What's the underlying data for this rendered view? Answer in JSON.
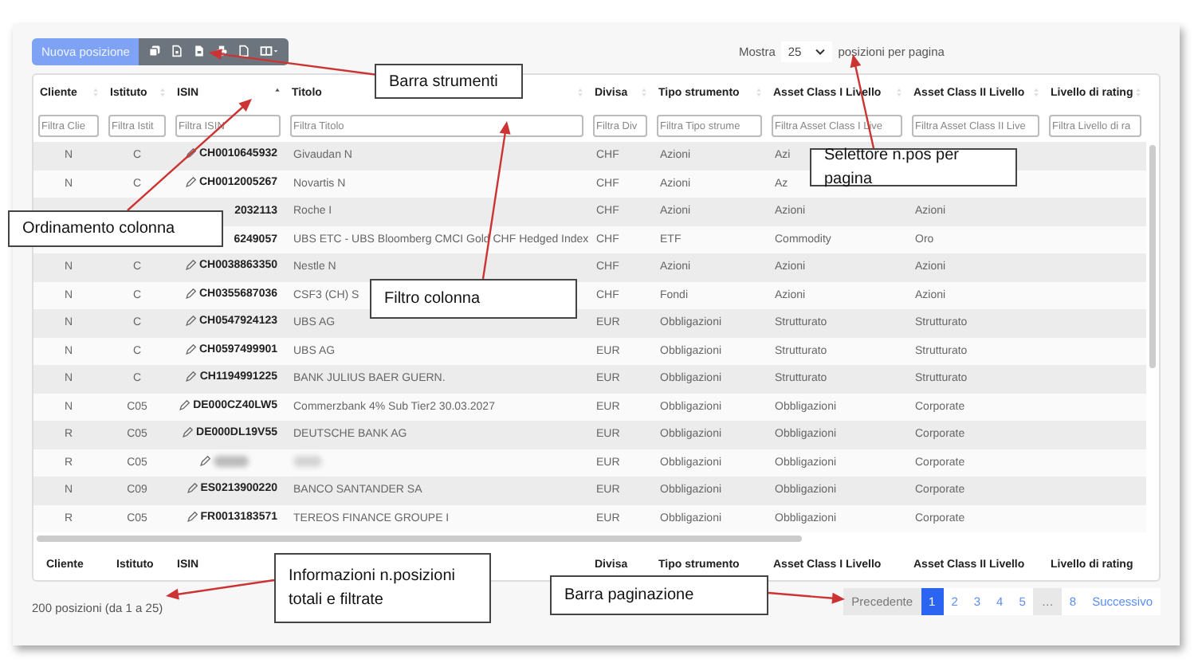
{
  "toolbar": {
    "new_button": "Nuova posizione"
  },
  "page_size": {
    "label_before": "Mostra",
    "value": "25",
    "label_after": "posizioni per pagina"
  },
  "table": {
    "columns": [
      {
        "label": "Cliente",
        "filter_placeholder": "Filtra Clie",
        "sorted": false
      },
      {
        "label": "Istituto",
        "filter_placeholder": "Filtra Istit",
        "sorted": false
      },
      {
        "label": "ISIN",
        "filter_placeholder": "Filtra ISIN",
        "sorted": true
      },
      {
        "label": "Titolo",
        "filter_placeholder": "Filtra Titolo",
        "sorted": false
      },
      {
        "label": "Divisa",
        "filter_placeholder": "Filtra Div",
        "sorted": false
      },
      {
        "label": "Tipo strumento",
        "filter_placeholder": "Filtra Tipo strume",
        "sorted": false
      },
      {
        "label": "Asset Class I Livello",
        "filter_placeholder": "Filtra Asset Class I Live",
        "sorted": false
      },
      {
        "label": "Asset Class II Livello",
        "filter_placeholder": "Filtra Asset Class II Live",
        "sorted": false
      },
      {
        "label": "Livello di rating",
        "filter_placeholder": "Filtra Livello di ra",
        "sorted": false
      }
    ],
    "rows": [
      {
        "edit": true,
        "redacted": false,
        "cells": [
          "N",
          "C",
          "CH0010645932",
          "Givaudan N",
          "CHF",
          "Azioni",
          "Azi",
          null,
          null
        ]
      },
      {
        "edit": true,
        "redacted": false,
        "cells": [
          "N",
          "C",
          "CH0012005267",
          "Novartis N",
          "CHF",
          "Azioni",
          "Az",
          null,
          null
        ]
      },
      {
        "edit": false,
        "redacted": false,
        "cells": [
          null,
          null,
          "2032113",
          "Roche I",
          "CHF",
          "Azioni",
          "Azioni",
          "Azioni",
          null
        ]
      },
      {
        "edit": false,
        "redacted": false,
        "cells": [
          null,
          null,
          "6249057",
          "UBS ETC - UBS Bloomberg CMCI Gold CHF Hedged Index",
          "CHF",
          "ETF",
          "Commodity",
          "Oro",
          null
        ]
      },
      {
        "edit": true,
        "redacted": false,
        "cells": [
          "N",
          "C",
          "CH0038863350",
          "Nestle N",
          "CHF",
          "Azioni",
          "Azioni",
          "Azioni",
          null
        ]
      },
      {
        "edit": true,
        "redacted": false,
        "cells": [
          "N",
          "C",
          "CH0355687036",
          "CSF3 (CH) S",
          "CHF",
          "Fondi",
          "Azioni",
          "Azioni",
          null
        ]
      },
      {
        "edit": true,
        "redacted": false,
        "cells": [
          "N",
          "C",
          "CH0547924123",
          "UBS AG",
          "EUR",
          "Obbligazioni",
          "Strutturato",
          "Strutturato",
          null
        ]
      },
      {
        "edit": true,
        "redacted": false,
        "cells": [
          "N",
          "C",
          "CH0597499901",
          "UBS AG",
          "EUR",
          "Obbligazioni",
          "Strutturato",
          "Strutturato",
          null
        ]
      },
      {
        "edit": true,
        "redacted": false,
        "cells": [
          "N",
          "C",
          "CH1194991225",
          "BANK JULIUS BAER GUERN.",
          "EUR",
          "Obbligazioni",
          "Strutturato",
          "Strutturato",
          null
        ]
      },
      {
        "edit": true,
        "redacted": false,
        "cells": [
          "N",
          "C05",
          "DE000CZ40LW5",
          "Commerzbank 4% Sub Tier2 30.03.2027",
          "EUR",
          "Obbligazioni",
          "Obbligazioni",
          "Corporate",
          null
        ]
      },
      {
        "edit": true,
        "redacted": false,
        "cells": [
          "R",
          "C05",
          "DE000DL19V55",
          "DEUTSCHE BANK AG",
          "EUR",
          "Obbligazioni",
          "Obbligazioni",
          "Corporate",
          null
        ]
      },
      {
        "edit": true,
        "redacted": true,
        "cells": [
          "R",
          "C05",
          null,
          null,
          "EUR",
          "Obbligazioni",
          "Obbligazioni",
          "Corporate",
          null
        ]
      },
      {
        "edit": true,
        "redacted": false,
        "cells": [
          "N",
          "C09",
          "ES0213900220",
          "BANCO SANTANDER SA",
          "EUR",
          "Obbligazioni",
          "Obbligazioni",
          "Corporate",
          null
        ]
      },
      {
        "edit": true,
        "redacted": false,
        "cells": [
          "R",
          "C05",
          "FR0013183571",
          "TEREOS FINANCE GROUPE I",
          "EUR",
          "Obbligazioni",
          "Obbligazioni",
          "Corporate",
          null
        ]
      }
    ],
    "footer_columns": [
      "Cliente",
      "Istituto",
      "ISIN",
      null,
      "Divisa",
      "Tipo strumento",
      "Asset Class I Livello",
      "Asset Class II Livello",
      "Livello di rating"
    ]
  },
  "info": "200 posizioni (da 1 a 25)",
  "pagination": [
    {
      "label": "Precedente",
      "selected": false,
      "disabled": true
    },
    {
      "label": "1",
      "selected": true,
      "disabled": false
    },
    {
      "label": "2",
      "selected": false,
      "disabled": false
    },
    {
      "label": "3",
      "selected": false,
      "disabled": false
    },
    {
      "label": "4",
      "selected": false,
      "disabled": false
    },
    {
      "label": "5",
      "selected": false,
      "disabled": false
    },
    {
      "label": "…",
      "selected": false,
      "disabled": true
    },
    {
      "label": "8",
      "selected": false,
      "disabled": false
    },
    {
      "label": "Successivo",
      "selected": false,
      "disabled": false
    }
  ],
  "callouts": [
    {
      "text": "Barra strumenti"
    },
    {
      "text": "Selettore n.pos per pagina"
    },
    {
      "text": "Ordinamento colonna"
    },
    {
      "text": "Filtro colonna"
    },
    {
      "text": "Informazioni n.posizioni totali e filtrate"
    },
    {
      "text": "Barra paginazione"
    }
  ]
}
